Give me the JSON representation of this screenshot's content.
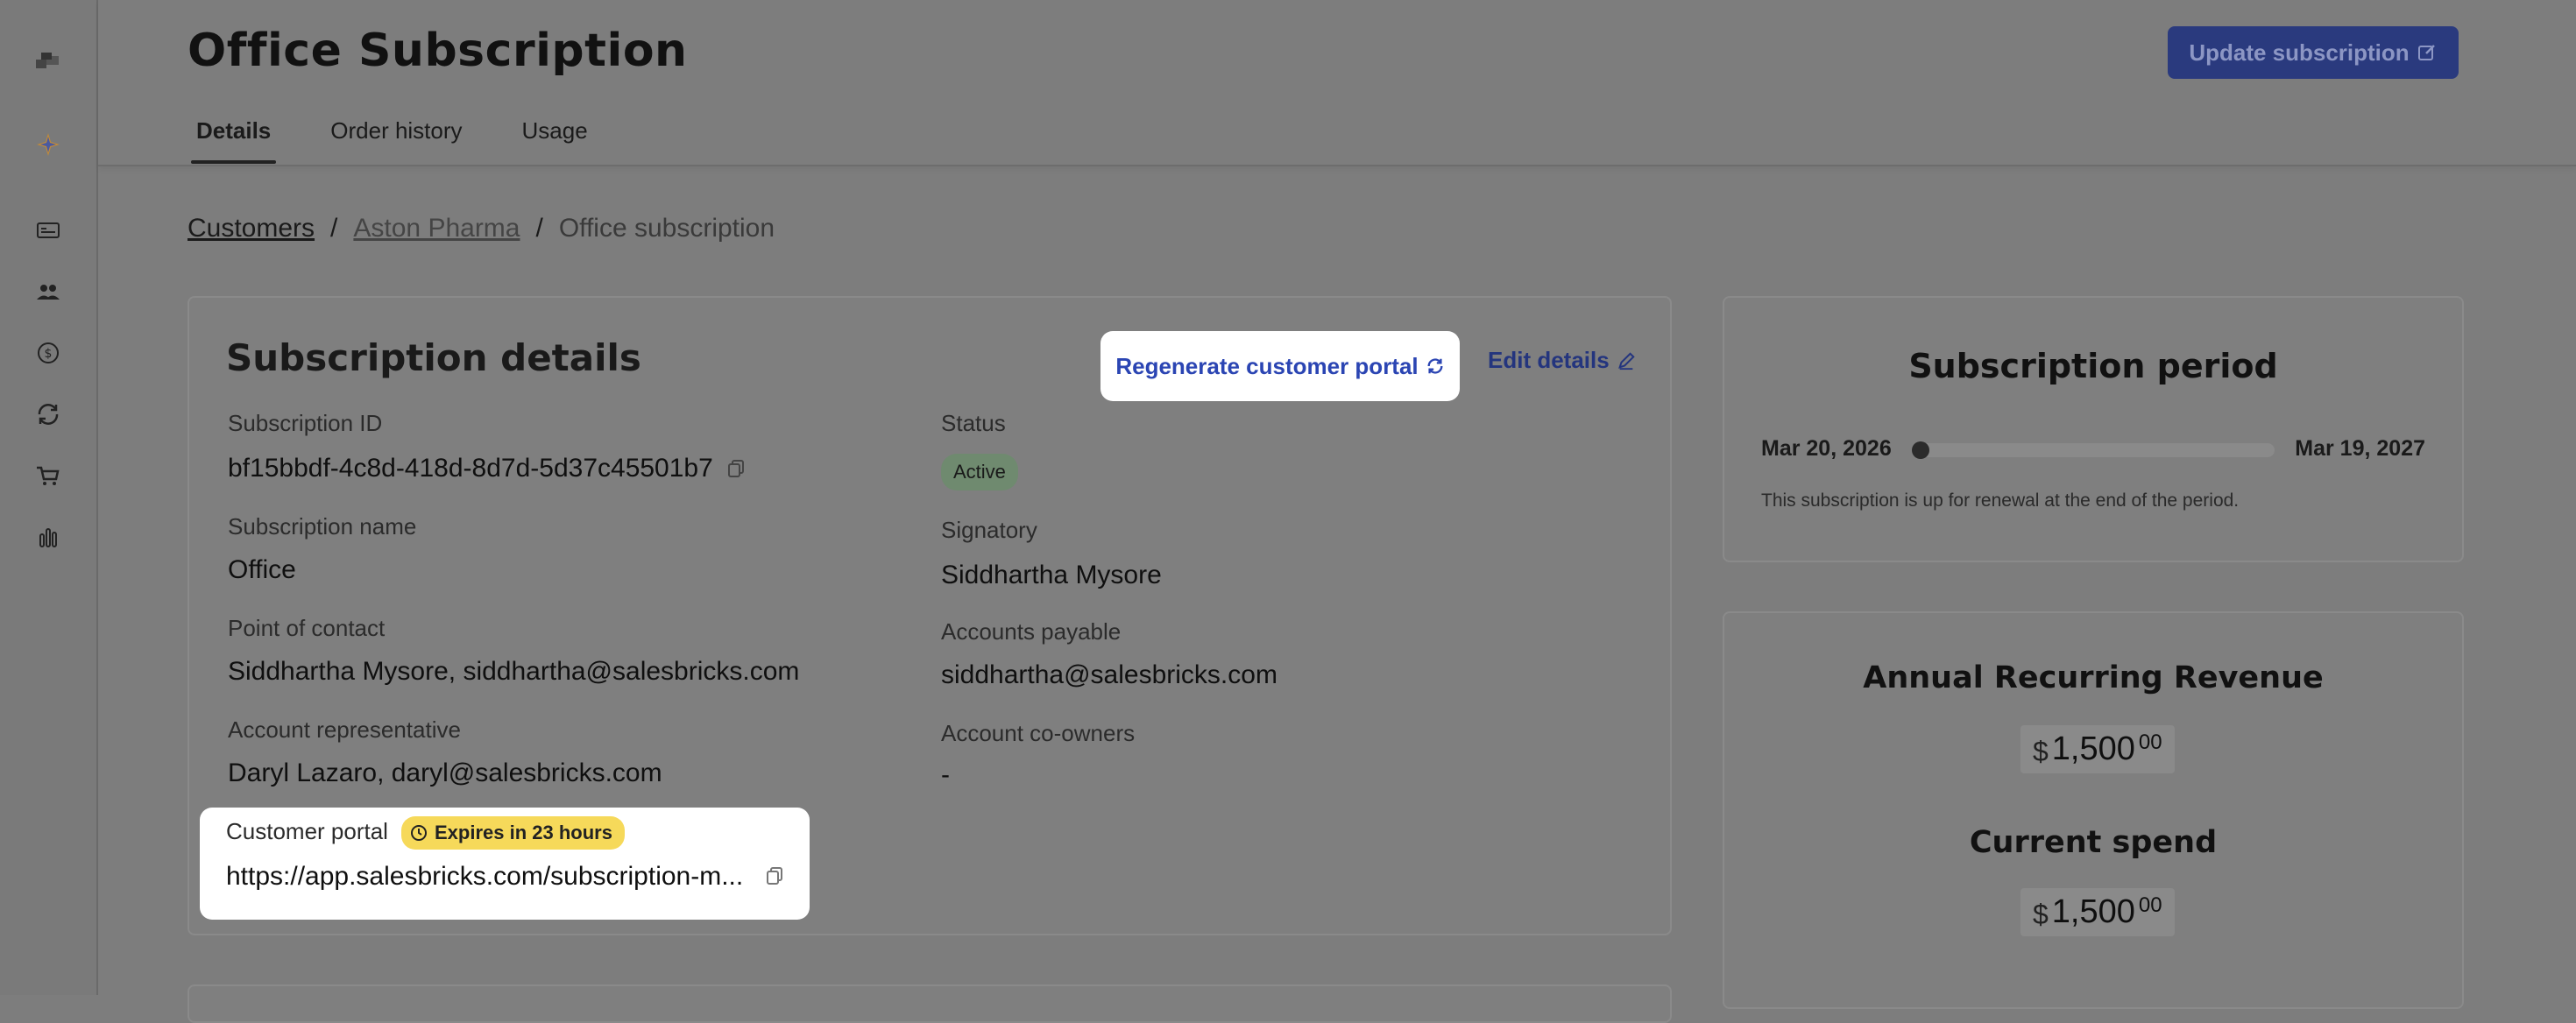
{
  "header": {
    "title": "Office Subscription",
    "update_button": "Update subscription",
    "tabs": [
      "Details",
      "Order history",
      "Usage"
    ]
  },
  "breadcrumb": {
    "customers": "Customers",
    "account": "Aston Pharma",
    "current": "Office subscription",
    "separator": "/"
  },
  "details": {
    "title": "Subscription details",
    "regenerate_label": "Regenerate customer portal",
    "edit_label": "Edit details",
    "subscription_id_label": "Subscription ID",
    "subscription_id": "bf15bbdf-4c8d-418d-8d7d-5d37c45501b7",
    "status_label": "Status",
    "status": "Active",
    "subscription_name_label": "Subscription name",
    "subscription_name": "Office",
    "signatory_label": "Signatory",
    "signatory": "Siddhartha Mysore",
    "point_of_contact_label": "Point of contact",
    "point_of_contact": "Siddhartha Mysore, siddhartha@salesbricks.com",
    "accounts_payable_label": "Accounts payable",
    "accounts_payable": "siddhartha@salesbricks.com",
    "account_rep_label": "Account representative",
    "account_rep": "Daryl Lazaro, daryl@salesbricks.com",
    "co_owners_label": "Account co-owners",
    "co_owners": "-",
    "portal_label": "Customer portal",
    "portal_expiry": "Expires in 23 hours",
    "portal_url": "https://app.salesbricks.com/subscription-m..."
  },
  "period": {
    "title": "Subscription period",
    "start": "Mar 20, 2026",
    "end": "Mar 19, 2027",
    "note": "This subscription is up for renewal at the end of the period.",
    "elapsed_fraction": 0.0
  },
  "revenue": {
    "arr_title": "Annual Recurring Revenue",
    "arr_currency": "$",
    "arr_value": "1,500",
    "arr_cents": "00",
    "spend_title": "Current spend",
    "spend_currency": "$",
    "spend_value": "1,500",
    "spend_cents": "00"
  },
  "colors": {
    "primary": "#2a3a7e",
    "link": "#2b45b3",
    "badge_yellow": "#f6d95a",
    "status_green": "#6f8a6f"
  }
}
